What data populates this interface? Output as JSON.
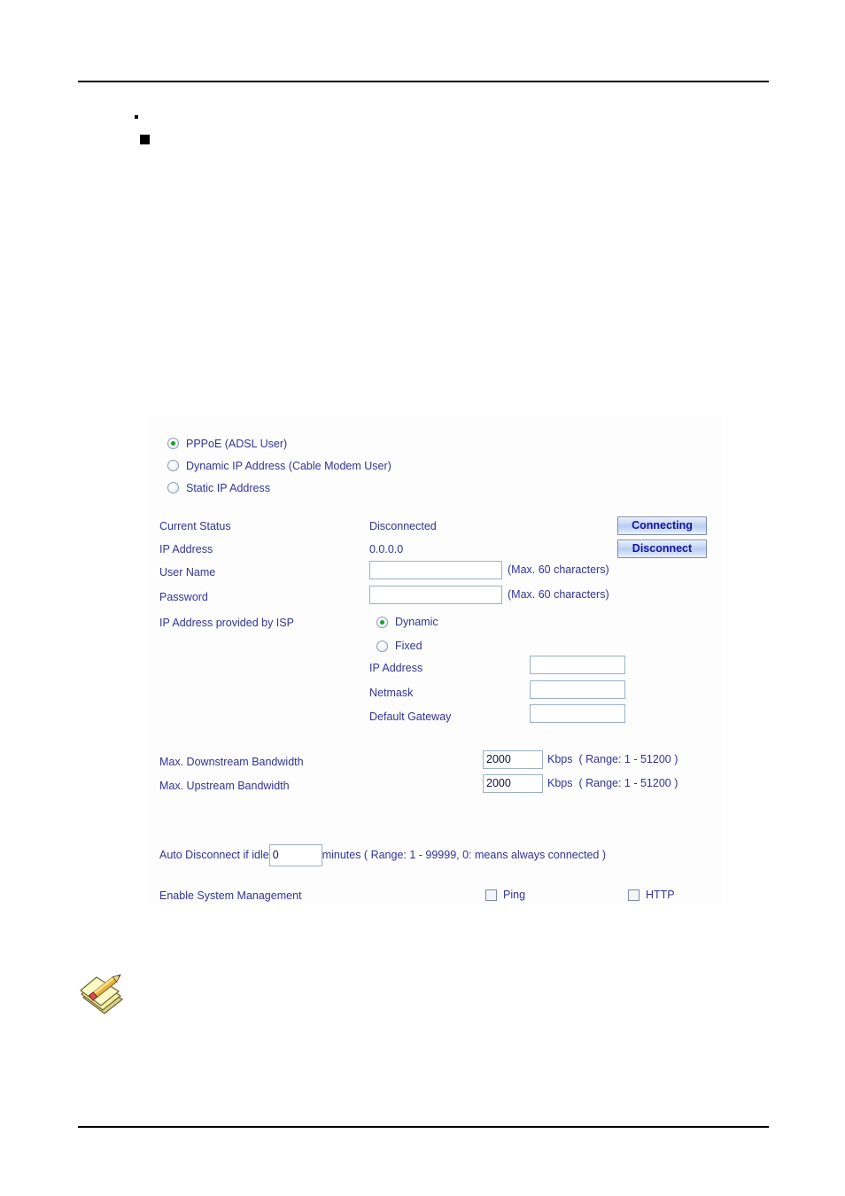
{
  "document": {
    "bullet_marker_small": "·",
    "bullet_marker_square": "■"
  },
  "panel": {
    "connection_types": [
      {
        "label": "PPPoE (ADSL User)",
        "selected": true
      },
      {
        "label": "Dynamic IP Address (Cable Modem User)",
        "selected": false
      },
      {
        "label": "Static IP Address",
        "selected": false
      }
    ],
    "current_status": {
      "label": "Current Status",
      "value": "Disconnected"
    },
    "ip_address": {
      "label": "IP Address",
      "value": "0.0.0.0"
    },
    "user_name": {
      "label": "User Name",
      "value": "",
      "hint": "(Max. 60 characters)"
    },
    "password": {
      "label": "Password",
      "value": "",
      "hint": "(Max. 60 characters)"
    },
    "buttons": {
      "connecting": "Connecting",
      "disconnect": "Disconnect"
    },
    "isp_ip": {
      "label": "IP Address provided by ISP",
      "options": [
        {
          "label": "Dynamic",
          "selected": true
        },
        {
          "label": "Fixed",
          "selected": false
        }
      ],
      "fields": [
        {
          "label": "IP Address",
          "value": ""
        },
        {
          "label": "Netmask",
          "value": ""
        },
        {
          "label": "Default Gateway",
          "value": ""
        }
      ]
    },
    "bandwidth": [
      {
        "label": "Max. Downstream Bandwidth",
        "value": "2000",
        "unit": "Kbps",
        "range": "( Range: 1 - 51200 )"
      },
      {
        "label": "Max. Upstream Bandwidth",
        "value": "2000",
        "unit": "Kbps",
        "range": "( Range: 1 - 51200 )"
      }
    ],
    "auto_disconnect": {
      "label": "Auto Disconnect if idle",
      "value": "0",
      "suffix": "minutes ( Range: 1 - 99999, 0: means always connected )"
    },
    "system_management": {
      "label": "Enable System Management",
      "options": [
        {
          "label": "Ping",
          "checked": false
        },
        {
          "label": "HTTP",
          "checked": false
        }
      ]
    }
  },
  "colors": {
    "text_blue": "#333399",
    "input_border": "#9bb0c8",
    "button_text": "#1414a0",
    "radio_dot": "#1f9a2e",
    "rule": "#000000",
    "panel_bg": "#fdfdfe"
  },
  "icons": {
    "note": "note-pencil-icon"
  }
}
